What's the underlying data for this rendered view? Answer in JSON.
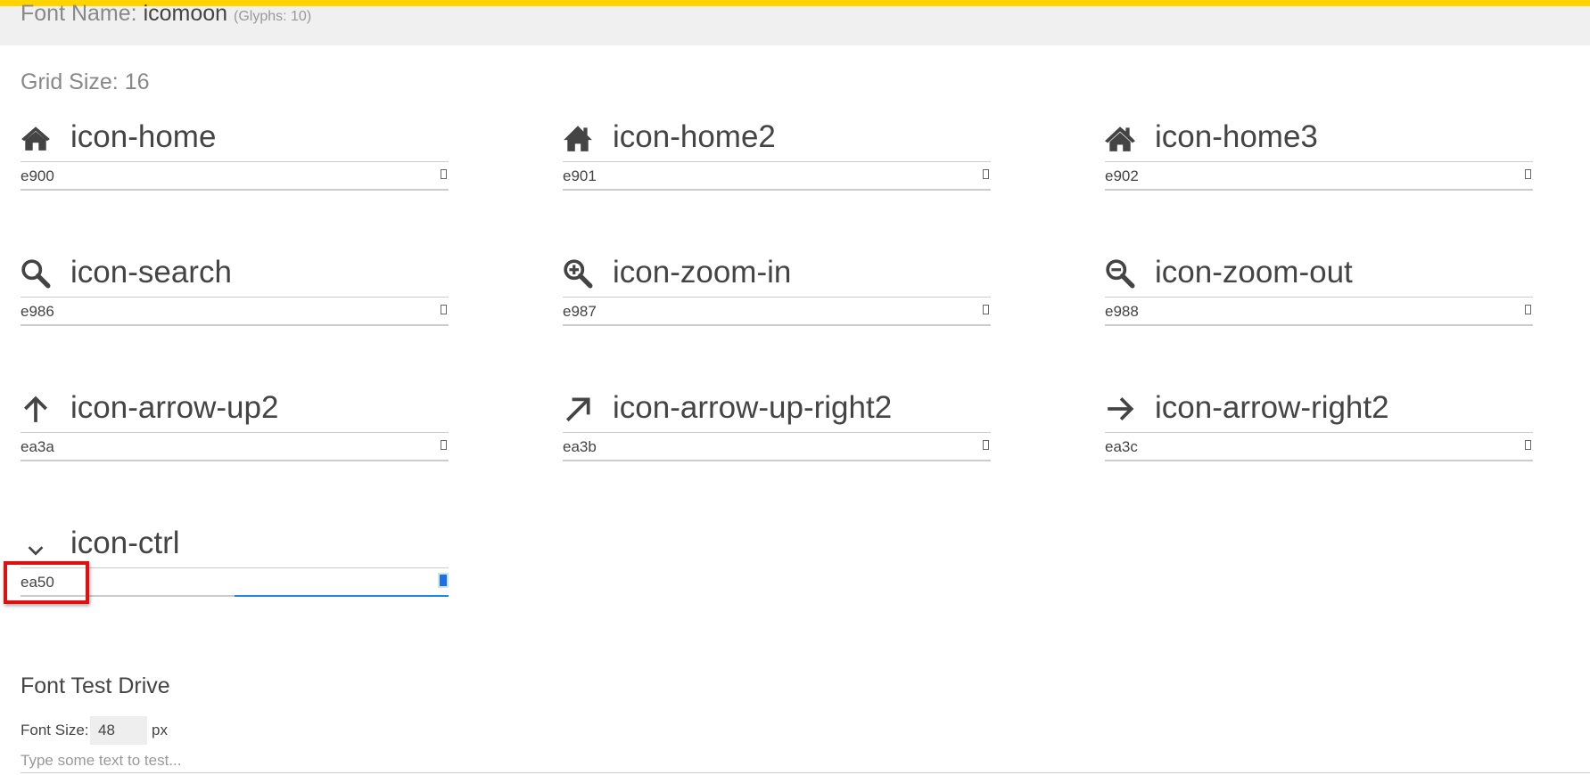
{
  "header": {
    "font_name_label": "Font Name:",
    "font_name_value": "icomoon",
    "glyph_count": "(Glyphs: 10)"
  },
  "grid_size": "Grid Size: 16",
  "glyphs": [
    {
      "name": "icon-home",
      "code": "e900",
      "icon": "home-icon"
    },
    {
      "name": "icon-home2",
      "code": "e901",
      "icon": "home2-icon"
    },
    {
      "name": "icon-home3",
      "code": "e902",
      "icon": "home3-icon"
    },
    {
      "name": "icon-search",
      "code": "e986",
      "icon": "search-icon"
    },
    {
      "name": "icon-zoom-in",
      "code": "e987",
      "icon": "zoom-in-icon"
    },
    {
      "name": "icon-zoom-out",
      "code": "e988",
      "icon": "zoom-out-icon"
    },
    {
      "name": "icon-arrow-up2",
      "code": "ea3a",
      "icon": "arrow-up-icon"
    },
    {
      "name": "icon-arrow-up-right2",
      "code": "ea3b",
      "icon": "arrow-up-right-icon"
    },
    {
      "name": "icon-arrow-right2",
      "code": "ea3c",
      "icon": "arrow-right-icon"
    },
    {
      "name": "icon-ctrl",
      "code": "ea50",
      "icon": "ctrl-chevron-icon"
    }
  ],
  "test_drive": {
    "title": "Font Test Drive",
    "font_size_label": "Font Size:",
    "font_size_value": "48",
    "font_size_unit": "px",
    "text_placeholder": "Type some text to test..."
  },
  "colors": {
    "top_bar": "#ffd400",
    "header_bg": "#f0f0f0",
    "highlight": "#e01010",
    "active_underline": "#1e88e5"
  }
}
